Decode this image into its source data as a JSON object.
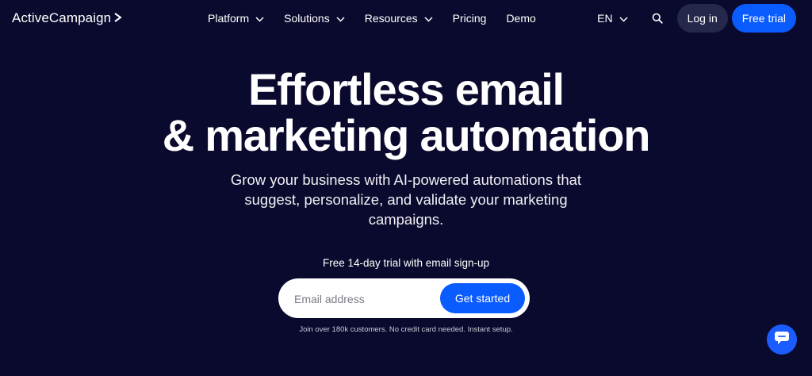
{
  "nav": {
    "logo": "ActiveCampaign",
    "logo_icon": "chevron-right-icon",
    "menu": [
      {
        "label": "Platform",
        "has_dropdown": true
      },
      {
        "label": "Solutions",
        "has_dropdown": true
      },
      {
        "label": "Resources",
        "has_dropdown": true
      },
      {
        "label": "Pricing",
        "has_dropdown": false
      },
      {
        "label": "Demo",
        "has_dropdown": false
      }
    ],
    "language": "EN",
    "search_icon": "search-icon",
    "login_label": "Log in",
    "trial_label": "Free trial"
  },
  "hero": {
    "title_line1": "Effortless email",
    "title_line2": "& marketing automation",
    "subtitle_line1": "Grow your business with AI-powered automations that",
    "subtitle_line2": "suggest, personalize, and validate your marketing",
    "subtitle_line3": "campaigns.",
    "trial_note": "Free 14-day trial with email sign-up",
    "email_placeholder": "Email address",
    "cta_label": "Get started",
    "fine_print": "Join over 180k customers. No credit card needed. Instant setup."
  },
  "chat": {
    "icon": "chat-icon"
  },
  "colors": {
    "background": "#0a0a2e",
    "primary": "#0a5cff",
    "login_bg": "#25284a"
  }
}
